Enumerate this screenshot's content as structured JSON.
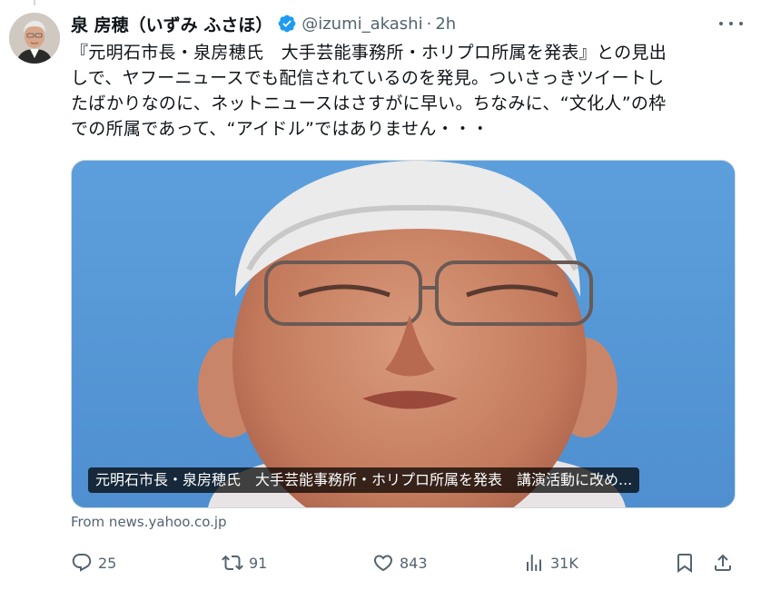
{
  "author": {
    "display_name": "泉 房穂（いずみ ふさほ）",
    "handle": "@izumi_akashi",
    "separator": "·",
    "time": "2h",
    "avatar_icon": "profile-photo",
    "verified_icon": "verified-badge-icon"
  },
  "tweet": {
    "lines": [
      "『元明石市長・泉房穂氏　大手芸能事務所・ホリプロ所属を発表』との見出",
      "しで、ヤフーニュースでも配信されているのを発見。ついさっきツイートし",
      "たばかりなのに、ネットニュースはさすがに早い。ちなみに、“文化人”の枠",
      "での所属であって、“アイドル”ではありません・・・"
    ]
  },
  "card": {
    "title": "元明石市長・泉房穂氏　大手芸能事務所・ホリプロ所属を発表　講演活動に改め...",
    "source": "From news.yahoo.co.jp"
  },
  "actions": {
    "reply": {
      "icon": "reply-icon",
      "count": "25"
    },
    "retweet": {
      "icon": "retweet-icon",
      "count": "91"
    },
    "like": {
      "icon": "heart-icon",
      "count": "843"
    },
    "views": {
      "icon": "views-icon",
      "count": "31K"
    },
    "bookmark": {
      "icon": "bookmark-icon"
    },
    "share": {
      "icon": "share-icon"
    }
  },
  "colors": {
    "text_primary": "#0f1419",
    "text_secondary": "#536471",
    "verified_blue": "#1d9bf0",
    "border": "#cfd9de",
    "sky": "#5a9ad8"
  }
}
